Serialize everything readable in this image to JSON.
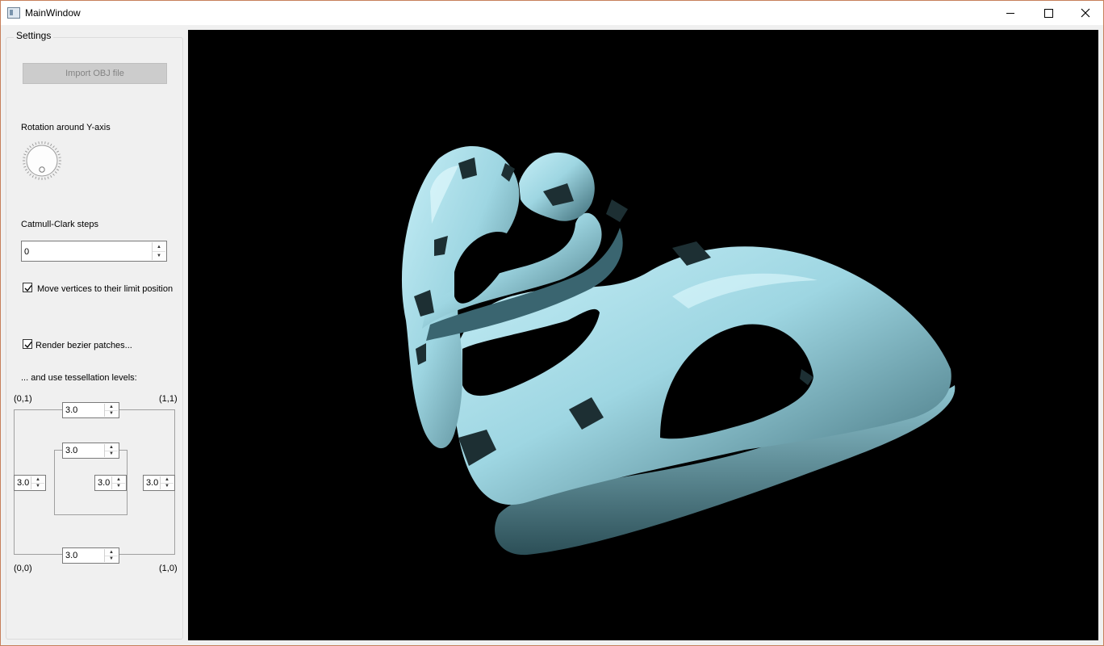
{
  "window": {
    "title": "MainWindow"
  },
  "settings": {
    "group_title": "Settings",
    "import_button": "Import OBJ file",
    "rotation_label": "Rotation around Y-axis",
    "catmull_label": "Catmull-Clark steps",
    "catmull_value": "0",
    "limit_position_label": "Move vertices to their limit position",
    "limit_position_checked": true,
    "render_bezier_label": "Render bezier patches...",
    "render_bezier_checked": true,
    "tessellation_label": "... and use tessellation levels:"
  },
  "tessellation": {
    "corner_01": "(0,1)",
    "corner_11": "(1,1)",
    "corner_00": "(0,0)",
    "corner_10": "(1,0)",
    "outer_top": "3.0",
    "inner_top": "3.0",
    "outer_left": "3.0",
    "inner_right": "3.0",
    "outer_right": "3.0",
    "outer_bottom": "3.0"
  },
  "colors": {
    "model": "#9ed6e2",
    "viewport_bg": "#000000",
    "window_border": "#c7805b"
  }
}
